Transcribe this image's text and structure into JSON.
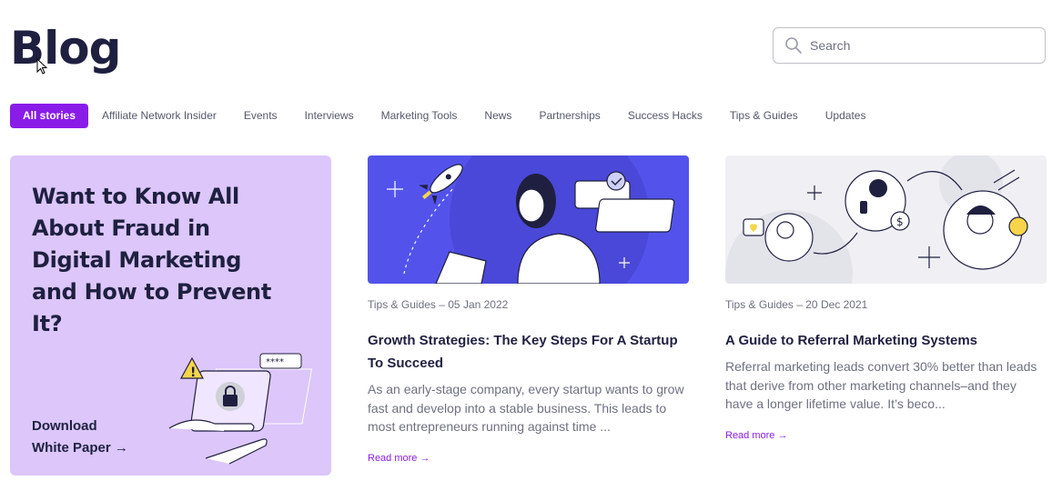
{
  "page": {
    "title": "Blog"
  },
  "search": {
    "placeholder": "Search"
  },
  "tabs": [
    {
      "label": "All stories",
      "active": true
    },
    {
      "label": "Affiliate Network Insider"
    },
    {
      "label": "Events"
    },
    {
      "label": "Interviews"
    },
    {
      "label": "Marketing Tools"
    },
    {
      "label": "News"
    },
    {
      "label": "Partnerships"
    },
    {
      "label": "Success Hacks"
    },
    {
      "label": "Tips & Guides"
    },
    {
      "label": "Updates"
    }
  ],
  "promo": {
    "title": "Want to Know All About Fraud in Digital Marketing and How to Prevent It?",
    "cta_line1": "Download",
    "cta_line2": "White Paper →"
  },
  "posts": [
    {
      "meta": "Tips & Guides – 05 Jan 2022",
      "title": "Growth Strategies: The Key Steps For A Startup To Succeed",
      "excerpt": "As an early-stage company, every startup wants to grow fast and develop into a stable business. This leads to most entrepreneurs running against time ...",
      "read_more": "Read more →",
      "image_icon": "woman-laptop-rocket-illustration"
    },
    {
      "meta": "Tips & Guides – 20 Dec 2021",
      "title": "A Guide to Referral Marketing Systems",
      "excerpt": "Referral marketing leads convert 30% better than leads that derive from other marketing channels–and they have a longer lifetime value. It’s beco...",
      "read_more": "Read more →",
      "image_icon": "referral-people-illustration"
    }
  ],
  "colors": {
    "accent": "#8a1ce8",
    "promo_bg": "#dcc6fa",
    "hero_blue": "#5353ec",
    "text_dark": "#1f2040"
  }
}
